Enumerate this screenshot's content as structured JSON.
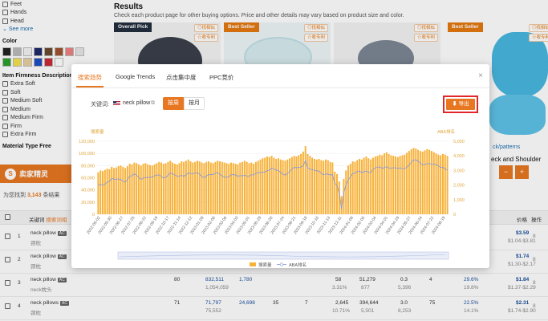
{
  "filters": {
    "body_parts": [
      "Feet",
      "Hands",
      "Head"
    ],
    "see_more": "See more",
    "color_heading": "Color",
    "colors": [
      "#222222",
      "#bbbbbb",
      "#f2f2f2",
      "#1e2a6b",
      "#6b4a2e",
      "#a0522d",
      "#f08080",
      "#e6e6e6",
      "#2ca02c",
      "#f5e050",
      "#e8cfa0",
      "#1f4fc4",
      "#cc2a36",
      "#ffffff"
    ],
    "firmness_heading": "Item Firmness Description",
    "firmness": [
      "Extra Soft",
      "Soft",
      "Medium Soft",
      "Medium",
      "Medium Firm",
      "Firm",
      "Extra Firm"
    ],
    "material_heading": "Material Type Free"
  },
  "results": {
    "title": "Results",
    "subtitle": "Check each product page for other buying options. Price and other details may vary based on product size and color.",
    "products": [
      {
        "badge": "Overall Pick",
        "tools": [
          "◎找相似",
          "☆收专利"
        ]
      },
      {
        "badge": "Best Seller",
        "tools": [
          "◎找相似",
          "☆收专利"
        ]
      },
      {
        "badge": "",
        "tools": [
          "◎找相似",
          "☆收专利"
        ]
      },
      {
        "badge": "",
        "tools": [
          "◎找相似",
          "☆收专利"
        ]
      },
      {
        "badge": "Best Seller",
        "tools": [
          "◎找相似",
          "☆收专利"
        ]
      }
    ],
    "right_link": "ck/patterns",
    "right_title": "eck and Shoulder"
  },
  "plugin": {
    "name": "卖家精灵",
    "found_prefix": "为您找到",
    "found_count": "3,143",
    "found_suffix": "条结果"
  },
  "table": {
    "headers": {
      "keyword": "关键词",
      "keyword_extra": "搜索词相",
      "price": "价格",
      "op": "操作"
    },
    "rows": [
      {
        "idx": "1",
        "kw": "neck pillow",
        "cn": "颈枕",
        "c1": "",
        "c2": "",
        "c3": "",
        "c4": "",
        "c5": "",
        "c6": "",
        "c7": "",
        "c8": "",
        "c9": "",
        "price": "$3.59",
        "price_range": "$1.04-$3.81",
        "op": "8"
      },
      {
        "idx": "2",
        "kw": "neck pillow",
        "cn": "颈枕",
        "c1": "",
        "c2": "",
        "c3": "",
        "c4": "",
        "c5": "",
        "c6": "",
        "c7": "",
        "c8": "",
        "c9": "",
        "price": "$1.74",
        "price_range": "$1.30-$2.17",
        "op": "8"
      },
      {
        "idx": "3",
        "kw": "neck pillow",
        "cn": "neck枕头",
        "c1": "80",
        "c2": "832,511",
        "c2b": "1,054,059",
        "c3": "1,780",
        "c4": "58",
        "c4b": "3.31%",
        "c5": "51,279",
        "c5b": "877",
        "c6": "0.3",
        "c6b": "5,396",
        "c7": "4",
        "c8": "29.6%",
        "c8b": "19.8%",
        "price": "$1.84",
        "price_range": "$1.37-$2.29",
        "op": "8"
      },
      {
        "idx": "4",
        "kw": "neck pillows",
        "cn": "颈枕",
        "c1": "71",
        "c2": "71,797",
        "c2b": "75,552",
        "c3": "24,698",
        "c3b": "35",
        "c3c": "7",
        "c4": "2,645",
        "c4b": "10.71%",
        "c5": "394,644",
        "c5b": "5,501",
        "c6": "3.0",
        "c6b": "8,253",
        "c7": "75",
        "c8": "22.5%",
        "c8b": "14.1%",
        "price": "$2.31",
        "price_range": "$1.74-$2.90",
        "op": "8"
      }
    ]
  },
  "modal": {
    "tabs": [
      "搜索趋势",
      "Google Trends",
      "点击集中度",
      "PPC竞价"
    ],
    "active_tab": 0,
    "close": "×",
    "keyword_label": "关键词:",
    "keyword_value": "neck pillow",
    "seg_on": "按周",
    "seg_off": "按月",
    "export_label": "导出"
  },
  "chart_data": {
    "type": "bar",
    "left_axis_label": "搜索量",
    "right_axis_label": "ABA排名",
    "left_ticks": [
      "0",
      "20,000",
      "40,000",
      "60,000",
      "80,000",
      "100,000",
      "120,000"
    ],
    "right_ticks": [
      "5,000",
      "4,000",
      "3,000",
      "2,000",
      "1,000",
      "0"
    ],
    "ylim": [
      0,
      120000
    ],
    "y2lim": [
      0,
      5000
    ],
    "dates": [
      "2022-05-02",
      "2022-05-30",
      "2022-06-27",
      "2022-07-25",
      "2022-08-22",
      "2022-09-19",
      "2022-10-17",
      "2022-11-14",
      "2022-12-12",
      "2023-01-09",
      "2023-02-06",
      "2023-03-06",
      "2023-04-03",
      "2023-05-01",
      "2023-05-29",
      "2023-06-26",
      "2023-07-24",
      "2023-08-21",
      "2023-09-18",
      "2023-10-16",
      "2023-11-13",
      "2023-12-11",
      "2024-01-08",
      "2024-02-05",
      "2024-03-04",
      "2024-04-01",
      "2024-04-29",
      "2024-05-27",
      "2024-06-24",
      "2024-07-22",
      "2024-08-19"
    ],
    "search_volume": [
      69000,
      72000,
      71000,
      73000,
      75000,
      74000,
      78000,
      76000,
      77000,
      79000,
      80000,
      78000,
      76000,
      79000,
      83000,
      82000,
      85000,
      84000,
      82000,
      80000,
      83000,
      84000,
      82000,
      81000,
      80000,
      82000,
      84000,
      86000,
      85000,
      83000,
      84000,
      86000,
      88000,
      85000,
      83000,
      82000,
      84000,
      87000,
      86000,
      88000,
      90000,
      87000,
      85000,
      86000,
      88000,
      87000,
      85000,
      84000,
      86000,
      87000,
      85000,
      84000,
      86000,
      88000,
      87000,
      86000,
      85000,
      84000,
      83000,
      85000,
      84000,
      83000,
      82000,
      85000,
      86000,
      88000,
      86000,
      84000,
      85000,
      83000,
      86000,
      88000,
      90000,
      92000,
      93000,
      95000,
      94000,
      96000,
      93000,
      91000,
      92000,
      90000,
      89000,
      88000,
      90000,
      92000,
      94000,
      96000,
      95000,
      97000,
      99000,
      103000,
      112000,
      99000,
      96000,
      93000,
      91000,
      90000,
      91000,
      89000,
      88000,
      90000,
      89000,
      86000,
      85000,
      70000,
      66000,
      54000,
      30000,
      58000,
      72000,
      80000,
      83000,
      87000,
      86000,
      89000,
      91000,
      90000,
      93000,
      95000,
      92000,
      90000,
      93000,
      95000,
      96000,
      98000,
      97000,
      100000,
      102000,
      99000,
      97000,
      96000,
      95000,
      94000,
      96000,
      97000,
      98000,
      101000,
      104000,
      107000,
      109000,
      108000,
      106000,
      104000,
      103000,
      105000,
      107000,
      106000,
      104000,
      102000,
      100000,
      98000,
      97000,
      99000,
      98000,
      96000
    ],
    "series_names": [
      "搜索量",
      "ABA排名"
    ],
    "legend_position": "bottom"
  }
}
